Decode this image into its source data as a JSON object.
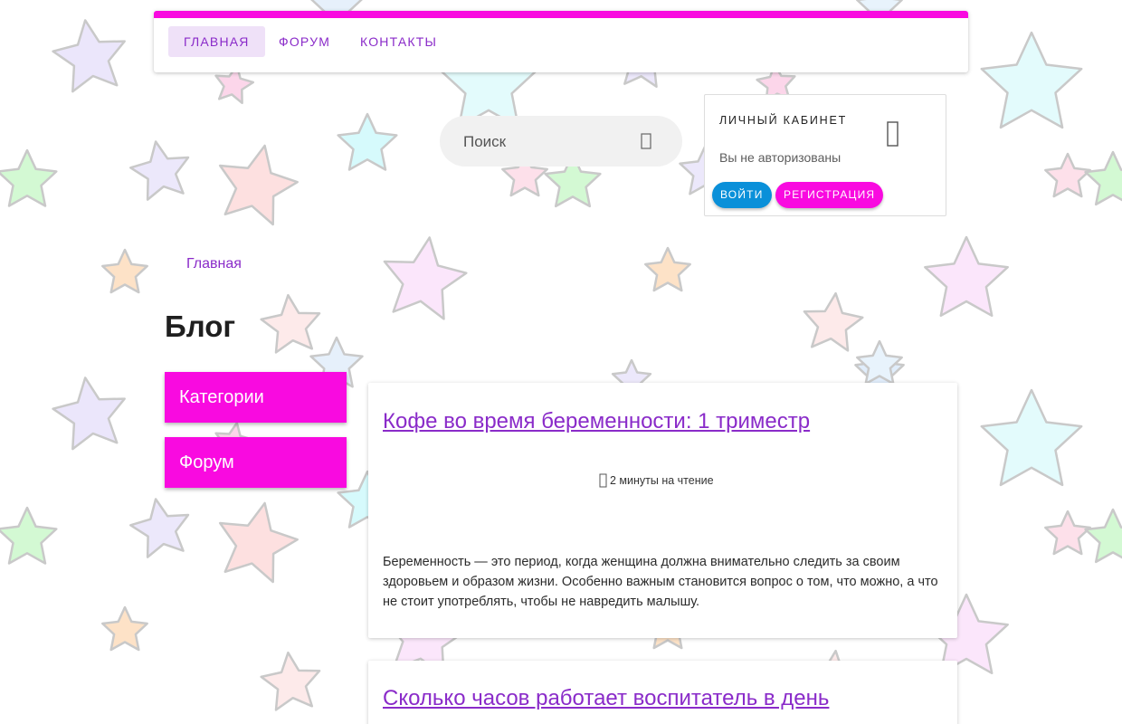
{
  "nav": {
    "items": [
      {
        "label": "ГЛАВНАЯ",
        "active": true
      },
      {
        "label": "ФОРУМ",
        "active": false
      },
      {
        "label": "КОНТАКТЫ",
        "active": false
      }
    ]
  },
  "search": {
    "placeholder": "Поиск",
    "icon": "search-icon"
  },
  "account": {
    "title": "ЛИЧНЫЙ КАБИНЕТ",
    "status": "Вы не авторизованы",
    "icon": "user-icon",
    "login_label": "ВОЙТИ",
    "register_label": "РЕГИСТРАЦИЯ"
  },
  "breadcrumb": {
    "home": "Главная"
  },
  "page": {
    "title": "Блог"
  },
  "sidebar": {
    "items": [
      {
        "label": "Категории"
      },
      {
        "label": "Форум"
      }
    ]
  },
  "posts": [
    {
      "title": "Кофе во время беременности: 1 триместр",
      "read_time": "2 минуты на чтение",
      "excerpt": "Беременность — это период, когда женщина должна внимательно следить за своим здоровьем и образом жизни. Особенно важным становится вопрос о том, что можно, а что не стоит употреблять, чтобы не навредить малышу."
    },
    {
      "title": "Сколько часов работает воспитатель в день"
    }
  ],
  "colors": {
    "accent_pink": "#f90ae0",
    "accent_purple": "#8a2bc9",
    "login_blue": "#0a90d9",
    "active_tab_bg": "#efe1f8"
  }
}
